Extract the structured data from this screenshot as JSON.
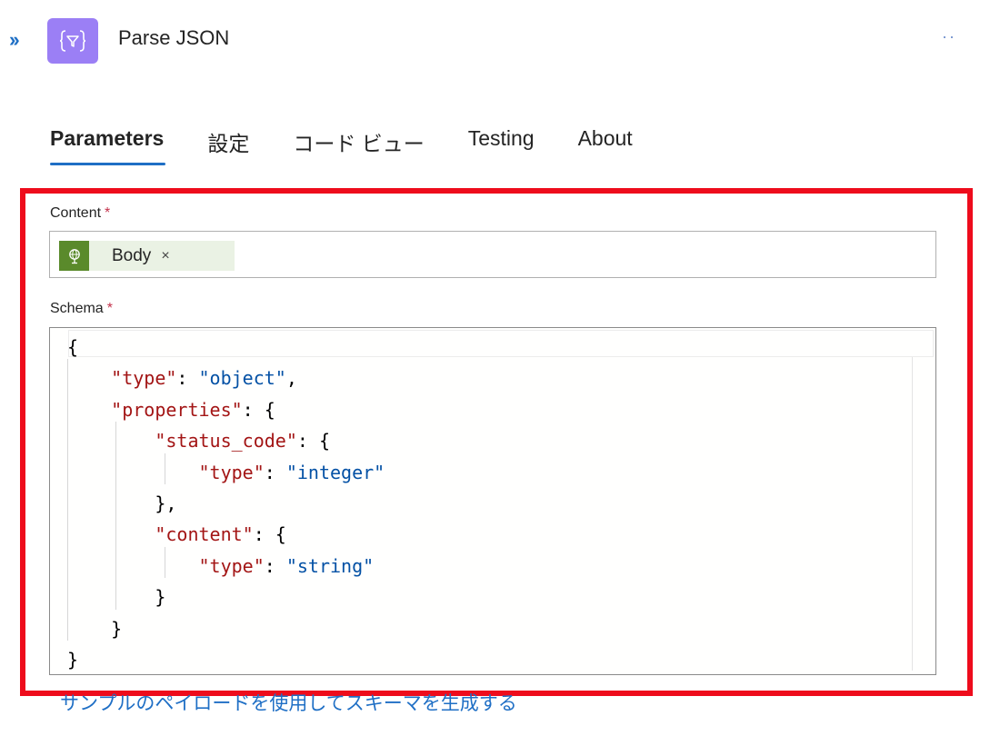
{
  "header": {
    "title": "Parse JSON",
    "expand_label": "››",
    "more_label": "··"
  },
  "tabs": [
    {
      "label": "Parameters",
      "active": true
    },
    {
      "label": "設定",
      "active": false
    },
    {
      "label": "コード ビュー",
      "active": false
    },
    {
      "label": "Testing",
      "active": false
    },
    {
      "label": "About",
      "active": false
    }
  ],
  "content_field": {
    "label": "Content",
    "required_mark": "*",
    "token": {
      "label": "Body",
      "remove": "×"
    }
  },
  "schema_field": {
    "label": "Schema",
    "required_mark": "*",
    "code_lines": [
      "{",
      "    \"type\": \"object\",",
      "    \"properties\": {",
      "        \"status_code\": {",
      "            \"type\": \"integer\"",
      "        },",
      "        \"content\": {",
      "            \"type\": \"string\"",
      "        }",
      "    }",
      "}"
    ]
  },
  "sample_link": "サンプルのペイロードを使用してスキーマを生成する",
  "colors": {
    "accent": "#1f6fc5",
    "highlight_border": "#ee0c1c",
    "action_icon_bg": "#9b7ff5",
    "token_icon_bg": "#5a8a2b",
    "json_key": "#a31515",
    "json_string": "#0451a5"
  },
  "icons": {
    "action": "curly-braces-filter-icon",
    "token": "globe-lightbulb-icon"
  }
}
